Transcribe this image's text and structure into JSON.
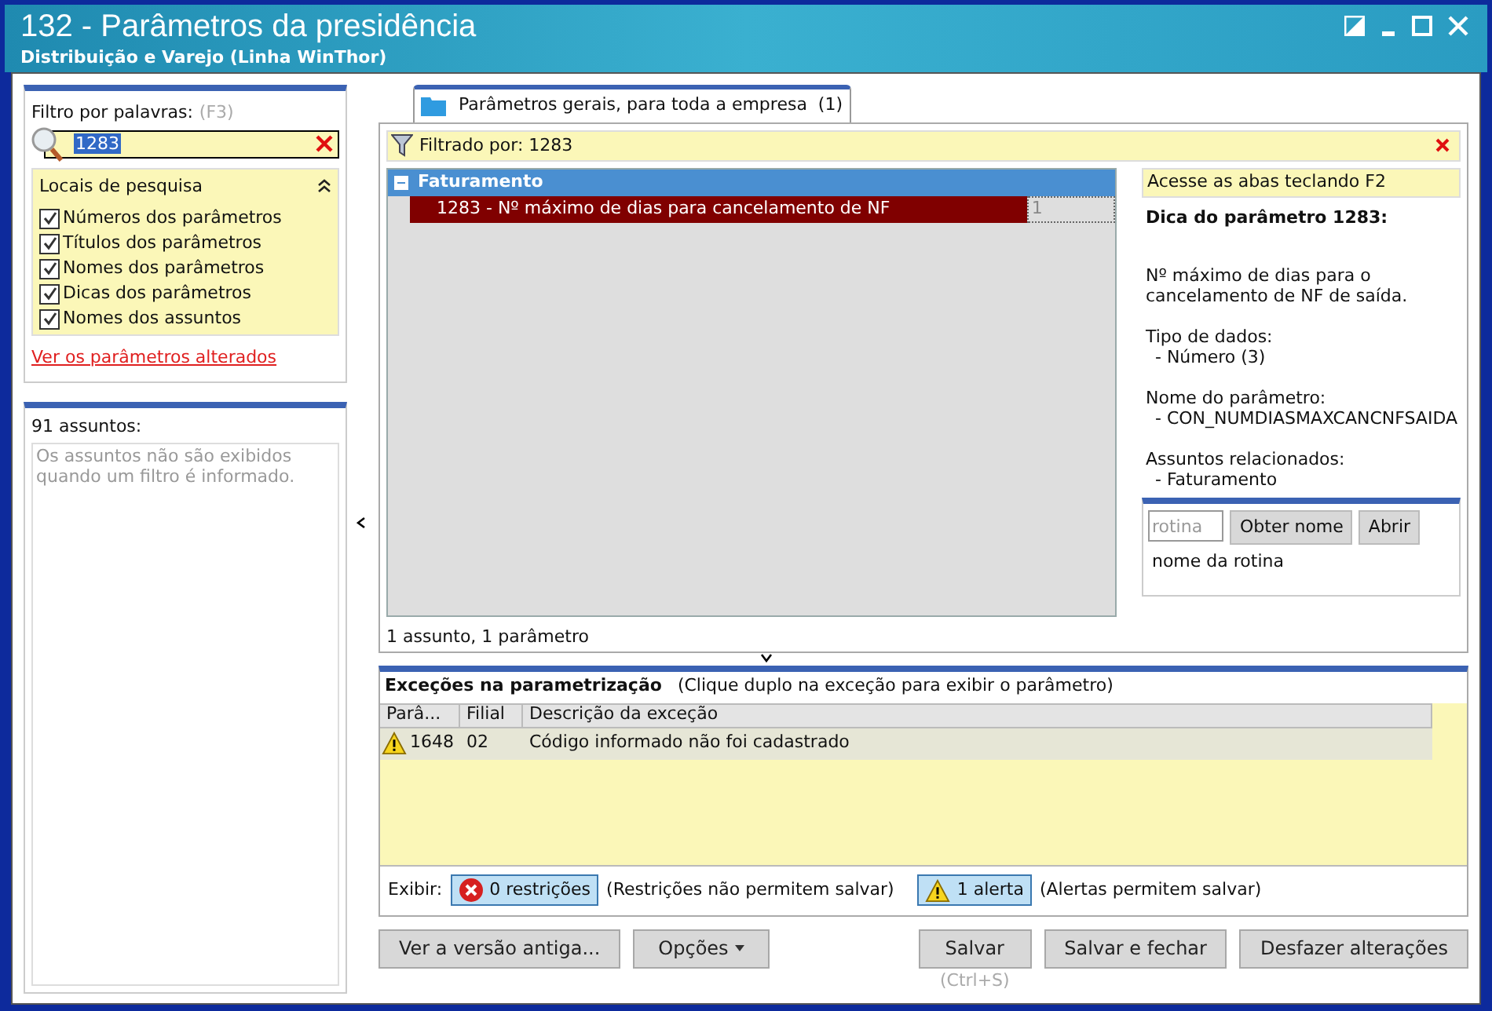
{
  "window": {
    "title": "132 - Parâmetros da presidência",
    "subtitle": "Distribuição e Varejo (Linha WinThor)"
  },
  "filter": {
    "label": "Filtro por palavras:",
    "shortcut": "(F3)",
    "value": "1283"
  },
  "search_locations": {
    "title": "Locais de pesquisa",
    "items": [
      {
        "label": "Números dos parâmetros",
        "checked": true
      },
      {
        "label": "Títulos dos parâmetros",
        "checked": true
      },
      {
        "label": "Nomes dos parâmetros",
        "checked": true
      },
      {
        "label": "Dicas dos parâmetros",
        "checked": true
      },
      {
        "label": "Nomes dos assuntos",
        "checked": true
      }
    ]
  },
  "changed_link": "Ver os parâmetros alterados",
  "subjects": {
    "count": "91 assuntos:",
    "message": "Os assuntos não são exibidos quando um filtro é informado."
  },
  "tabs": [
    {
      "label": "Parâmetros gerais, para toda a empresa  (1)",
      "selected": true
    }
  ],
  "filter_bar": {
    "text": "Filtrado por: 1283"
  },
  "tree": {
    "groups": [
      {
        "title": "Faturamento",
        "expanded": true,
        "children": [
          {
            "label": "1283 - Nº máximo de dias para cancelamento de NF",
            "value": "1",
            "selected": true
          }
        ]
      }
    ]
  },
  "tree_status": "1 assunto, 1 parâmetro",
  "tips": {
    "hint": "Acesse as abas teclando F2",
    "title": "Dica do parâmetro 1283:",
    "description": "Nº máximo de dias para o cancelamento de NF de saída.",
    "sections": [
      {
        "label": "Tipo de dados:",
        "value": "- Número (3)"
      },
      {
        "label": "Nome do parâmetro:",
        "value": "- CON_NUMDIASMAXCANCNFSAIDA"
      },
      {
        "label": "Assuntos relacionados:",
        "value": "- Faturamento"
      }
    ]
  },
  "routine": {
    "placeholder": "rotina",
    "buttons": [
      "Obter nome",
      "Abrir"
    ],
    "name": "nome da rotina"
  },
  "exceptions": {
    "title": "Exceções na parametrização",
    "hint": "(Clique duplo na exceção para exibir o parâmetro)",
    "columns": [
      "Parâ...",
      "Filial",
      "Descrição da exceção"
    ],
    "rows": [
      {
        "kind": "alert",
        "cells": [
          "1648",
          "02",
          "Código informado não foi cadastrado"
        ]
      }
    ]
  },
  "show": {
    "label": "Exibir:",
    "toggles": [
      {
        "kind": "error",
        "label": "0 restrições",
        "note": "(Restrições não permitem salvar)",
        "selected": true
      },
      {
        "kind": "alert",
        "label": "1 alerta",
        "note": "(Alertas permitem salvar)",
        "selected": true
      }
    ]
  },
  "left_buttons": [
    {
      "label": "Ver a versão antiga...",
      "menu": false
    },
    {
      "label": "Opções",
      "menu": true
    }
  ],
  "right_buttons": [
    {
      "label": "Salvar",
      "hint": "(Ctrl+S)"
    },
    {
      "label": "Salvar e fechar"
    },
    {
      "label": "Desfazer alterações"
    }
  ]
}
